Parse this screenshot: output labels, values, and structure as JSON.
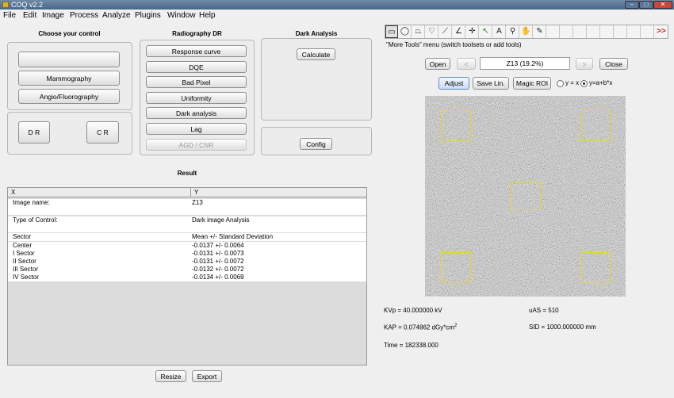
{
  "window": {
    "title": "COQ  v2.2"
  },
  "menu": [
    "File",
    "Edit",
    "Image",
    "Process",
    "Analyze",
    "Plugins",
    "Window",
    "Help"
  ],
  "choose": {
    "header": "Choose your control",
    "blank_label": "",
    "mammo": "Mammography",
    "angio": "Angio/Fluorography",
    "dr": "D R",
    "cr": "C R"
  },
  "radio_dr": {
    "header": "Radiography DR",
    "buttons": [
      "Response curve",
      "DQE",
      "Bad Pixel",
      "Uniformity",
      "Dark analysis",
      "Lag",
      "AGD / CNR"
    ]
  },
  "dark": {
    "header": "Dark Analysis",
    "calculate": "Calculate",
    "config": "Config"
  },
  "result": {
    "header": "Result",
    "col_x": "X",
    "col_y": "Y",
    "rows": [
      {
        "x": "Image name:",
        "y": "Z13"
      },
      {
        "x": "",
        "y": ""
      },
      {
        "x": "Type of Control:",
        "y": "Dark image Analysis"
      },
      {
        "x": "",
        "y": ""
      },
      {
        "x": "Sector",
        "y": "Mean +/- Standard Deviation"
      },
      {
        "x": "Center",
        "y": "-0.0137 +/- 0.0064"
      },
      {
        "x": "I Sector",
        "y": "-0.0131 +/- 0.0073"
      },
      {
        "x": "II Sector",
        "y": "-0.0131 +/- 0.0072"
      },
      {
        "x": "III Sector",
        "y": "-0.0132 +/- 0.0072"
      },
      {
        "x": "IV Sector",
        "y": "-0.0134 +/- 0.0069"
      }
    ],
    "resize": "Resize",
    "export": "Export"
  },
  "imagej": {
    "status": "\"More Tools\" menu (switch toolsets or add tools)",
    "open": "Open",
    "prev": "<",
    "image_name": "Z13 (19.2%)",
    "next": ">",
    "close": "Close",
    "adjust": "Adjust",
    "save_lin": "Save Lin.",
    "magic_roi": "Magic ROI",
    "radio1": "y = x",
    "radio2": "y=a+b*x",
    "more_tools": ">>",
    "accent": "#e6d53a"
  },
  "params": {
    "kvp": "KVp = 40.000000 kV",
    "uas": "uAS = 510",
    "kap": "KAP = 0.074862 dGy*cm",
    "kap_sup": "2",
    "sid": "SID = 1000.000000 mm",
    "time": "Time = 182338.000"
  }
}
